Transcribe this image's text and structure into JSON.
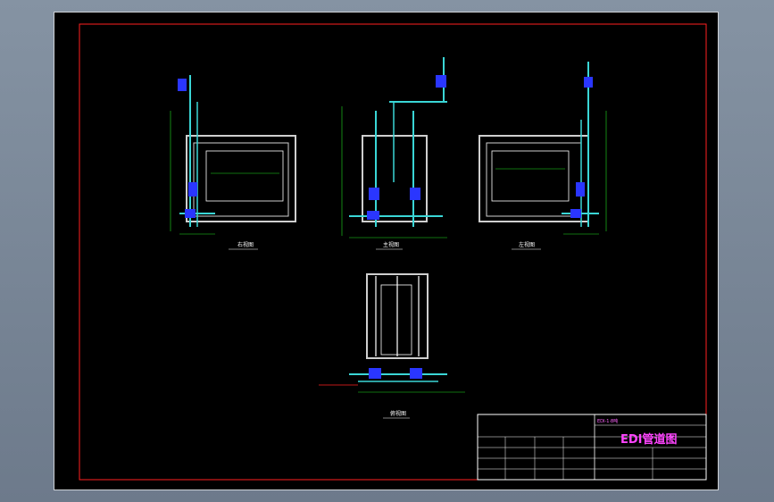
{
  "drawing": {
    "title": "EDI管道图",
    "subtitle": "EDI-1·8吨",
    "views": {
      "right": "右视图",
      "front": "主视图",
      "left": "左视图",
      "top": "俯视图"
    }
  },
  "colors": {
    "background": "#000000",
    "frame": "#ff2020",
    "pipe": "#3ad6d6",
    "valve": "#2a36ff",
    "dimension": "#22e022",
    "body": "#cfcfcf",
    "title": "#ff44ff"
  }
}
